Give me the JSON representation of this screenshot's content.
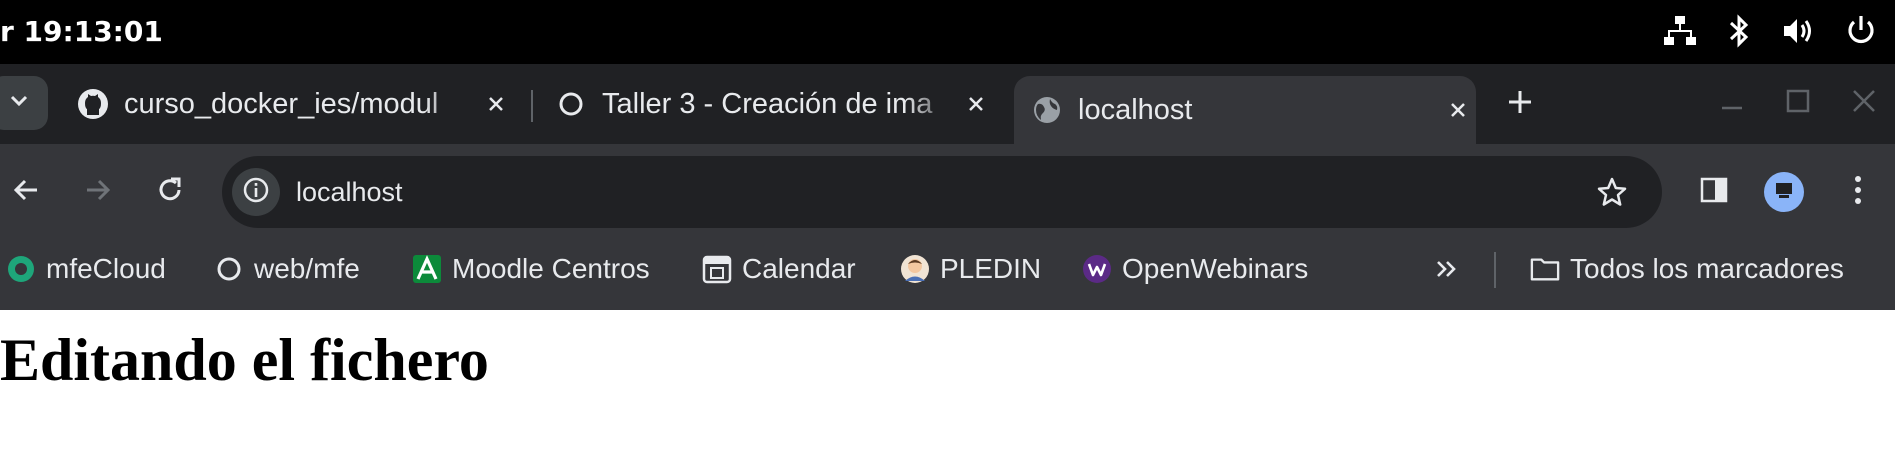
{
  "system_bar": {
    "clock": "r 19:13:01",
    "icons": [
      "network-icon",
      "bluetooth-icon",
      "volume-icon",
      "power-icon"
    ]
  },
  "tabs": [
    {
      "title": "curso_docker_ies/modul",
      "favicon": "github-icon",
      "active": false
    },
    {
      "title": "Taller 3 - Creación de ima",
      "favicon": "loading-circle-icon",
      "active": false
    },
    {
      "title": "localhost",
      "favicon": "globe-icon",
      "active": true
    }
  ],
  "toolbar": {
    "url": "localhost"
  },
  "bookmarks": [
    {
      "label": "mfeCloud",
      "icon": "mfecloud-icon"
    },
    {
      "label": "web/mfe",
      "icon": "circle-icon"
    },
    {
      "label": "Moodle Centros",
      "icon": "moodle-icon"
    },
    {
      "label": "Calendar",
      "icon": "calendar-icon"
    },
    {
      "label": "PLEDIN",
      "icon": "pledin-avatar-icon"
    },
    {
      "label": "OpenWebinars",
      "icon": "openwebinars-icon"
    }
  ],
  "all_bookmarks_label": "Todos los marcadores",
  "page": {
    "heading": "Editando el fichero"
  },
  "colors": {
    "system_bar": "#000000",
    "tabstrip": "#202124",
    "toolbar": "#35363a",
    "omnibox": "#202124",
    "text": "#e8eaed",
    "profile": "#8ab4f8"
  }
}
